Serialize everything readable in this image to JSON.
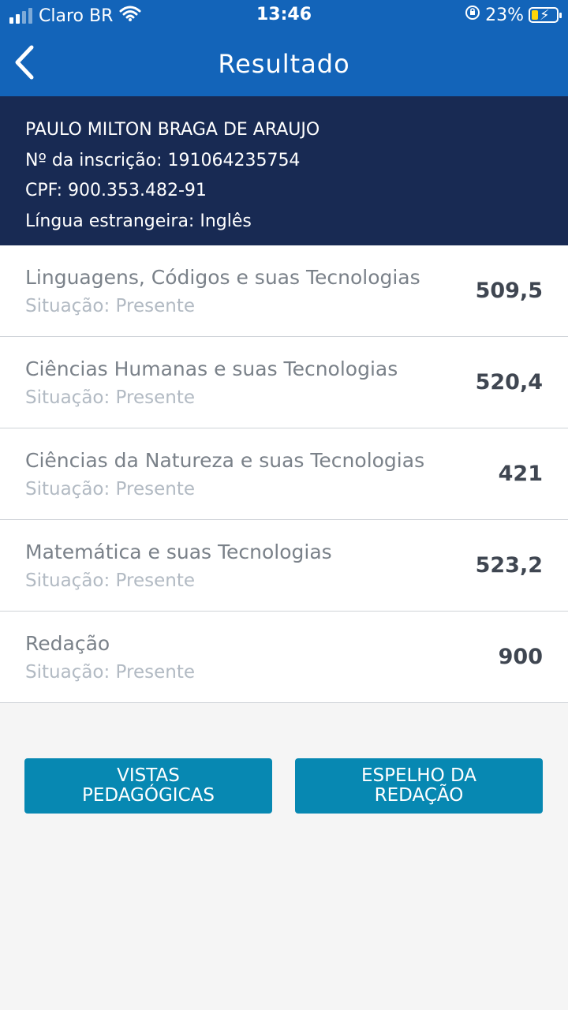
{
  "status_bar": {
    "carrier": "Claro BR",
    "time": "13:46",
    "battery": "23%",
    "icons": [
      "signal-icon",
      "wifi-icon",
      "orientation-lock-icon",
      "battery-charging-icon"
    ]
  },
  "nav": {
    "title": "Resultado",
    "back_icon": "chevron-left-icon"
  },
  "candidate": {
    "name": "PAULO MILTON BRAGA DE ARAUJO",
    "inscricao": "Nº da inscrição: 191064235754",
    "cpf": "CPF: 900.353.482-91",
    "lingua": "Língua estrangeira: Inglês"
  },
  "results": [
    {
      "area": "Linguagens, Códigos e suas Tecnologias",
      "situacao": "Situação: Presente",
      "score": "509,5"
    },
    {
      "area": "Ciências Humanas e suas Tecnologias",
      "situacao": "Situação: Presente",
      "score": "520,4"
    },
    {
      "area": "Ciências da Natureza e suas Tecnologias",
      "situacao": "Situação: Presente",
      "score": "421"
    },
    {
      "area": "Matemática e suas Tecnologias",
      "situacao": "Situação: Presente",
      "score": "523,2"
    },
    {
      "area": "Redação",
      "situacao": "Situação: Presente",
      "score": "900"
    }
  ],
  "buttons": {
    "vistas_line1": "VISTAS",
    "vistas_line2": "PEDAGÓGICAS",
    "espelho_line1": "ESPELHO DA",
    "espelho_line2": "REDAÇÃO"
  },
  "colors": {
    "header": "#1364b9",
    "candidate_bg": "#182a53",
    "button": "#0788b2",
    "battery_fill": "#ffd60a"
  }
}
